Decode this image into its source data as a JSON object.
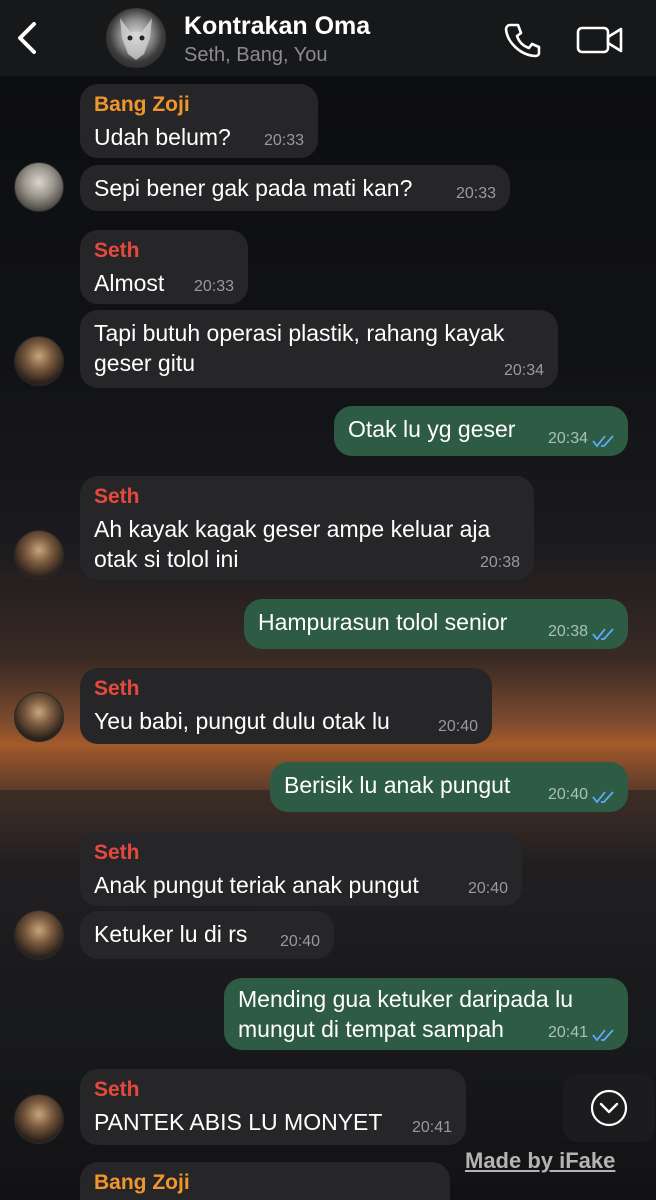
{
  "header": {
    "title": "Kontrakan Oma",
    "subtitle": "Seth, Bang, You"
  },
  "icons": {
    "back": "chevron-left-icon",
    "call": "phone-icon",
    "video": "video-camera-icon",
    "scroll": "chevron-down-icon"
  },
  "colors": {
    "incoming_bubble": "#262628",
    "outgoing_bubble": "#2e5b43",
    "sender_orange": "#f0962c",
    "sender_red": "#e5493d",
    "read_ticks": "#5fa8ff"
  },
  "messages": [
    {
      "sender": "Bang Zoji",
      "text": "Udah belum?",
      "time": "20:33"
    },
    {
      "text": "Sepi bener gak pada mati kan?",
      "time": "20:33"
    },
    {
      "sender": "Seth",
      "text": "Almost",
      "time": "20:33"
    },
    {
      "text_line1": "Tapi butuh operasi plastik, rahang kayak",
      "text_line2": "geser gitu",
      "time": "20:34"
    },
    {
      "text": "Otak lu yg geser",
      "time": "20:34"
    },
    {
      "sender": "Seth",
      "text_line1": "Ah kayak kagak geser ampe keluar aja",
      "text_line2": "otak si tolol ini",
      "time": "20:38"
    },
    {
      "text": "Hampurasun tolol senior",
      "time": "20:38"
    },
    {
      "sender": "Seth",
      "text": "Yeu babi, pungut dulu otak lu",
      "time": "20:40"
    },
    {
      "text": "Berisik lu anak pungut",
      "time": "20:40"
    },
    {
      "sender": "Seth",
      "text": "Anak pungut teriak anak pungut",
      "time": "20:40"
    },
    {
      "text": "Ketuker lu di rs",
      "time": "20:40"
    },
    {
      "text_line1": "Mending gua ketuker daripada lu",
      "text_line2": "mungut di tempat sampah",
      "time": "20:41"
    },
    {
      "sender": "Seth",
      "text": "PANTEK ABIS LU MONYET",
      "time": "20:41"
    },
    {
      "sender": "Bang Zoji"
    }
  ],
  "watermark": "Made by iFake"
}
